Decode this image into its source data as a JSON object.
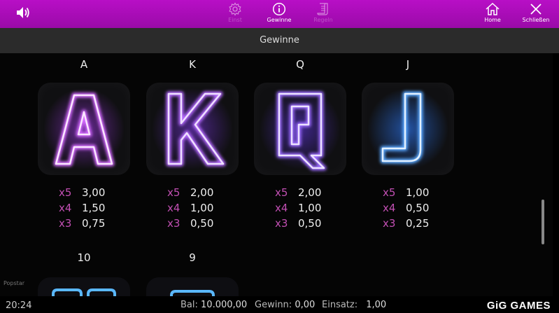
{
  "topbar": {
    "nav": [
      {
        "label": "Einst",
        "icon": "gear-icon"
      },
      {
        "label": "Gewinne",
        "icon": "info-icon"
      },
      {
        "label": "Regeln",
        "icon": "rules-icon"
      }
    ],
    "home_label": "Home",
    "close_label": "Schließen"
  },
  "header": {
    "title": "Gewinne"
  },
  "symbols": [
    {
      "letter": "A",
      "color": "#c94fff",
      "pays": [
        {
          "mult": "x5",
          "value": "3,00"
        },
        {
          "mult": "x4",
          "value": "1,50"
        },
        {
          "mult": "x3",
          "value": "0,75"
        }
      ]
    },
    {
      "letter": "K",
      "color": "#a64dff",
      "pays": [
        {
          "mult": "x5",
          "value": "2,00"
        },
        {
          "mult": "x4",
          "value": "1,00"
        },
        {
          "mult": "x3",
          "value": "0,50"
        }
      ]
    },
    {
      "letter": "Q",
      "color": "#8a4dff",
      "pays": [
        {
          "mult": "x5",
          "value": "2,00"
        },
        {
          "mult": "x4",
          "value": "1,00"
        },
        {
          "mult": "x3",
          "value": "0,50"
        }
      ]
    },
    {
      "letter": "J",
      "color": "#4d9dff",
      "pays": [
        {
          "mult": "x5",
          "value": "1,00"
        },
        {
          "mult": "x4",
          "value": "0,50"
        },
        {
          "mult": "x3",
          "value": "0,25"
        }
      ]
    }
  ],
  "symbols_row2": [
    {
      "letter": "10",
      "color": "#4dbdff"
    },
    {
      "letter": "9",
      "color": "#4dbdff"
    }
  ],
  "game_name": "Popstar",
  "status": {
    "clock": "20:24",
    "balance_label": "Bal:",
    "balance_value": "10.000,00",
    "win_label": "Gewinn:",
    "win_value": "0,00",
    "bet_label": "Einsatz:",
    "bet_value": "1,00",
    "brand": "GiG GAMES"
  }
}
